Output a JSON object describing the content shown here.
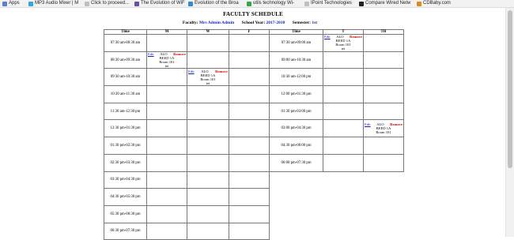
{
  "bookmarks": [
    {
      "label": "Apps",
      "icon": "apps-grid-icon"
    },
    {
      "label": "MP3 Audio Mixer | M",
      "icon": "page-icon"
    },
    {
      "label": "Click to proceed...",
      "icon": "page-icon"
    },
    {
      "label": "The Evolution of WiF",
      "icon": "page-icon"
    },
    {
      "label": "Evolution of the Broa",
      "icon": "page-icon"
    },
    {
      "label": "utils technology Wi-",
      "icon": "page-icon"
    },
    {
      "label": "IPoint Technologies",
      "icon": "page-icon"
    },
    {
      "label": "Compare Wired Netw",
      "icon": "page-icon"
    },
    {
      "label": "CDBaby.com",
      "icon": "page-icon"
    }
  ],
  "title": "FACULTY SCHEDULE",
  "info": {
    "faculty_label": "Faculty:",
    "faculty_value": "Mrs Admin Admin",
    "year_label": "School Year:",
    "year_value": "2017-2018",
    "semester_label": "Semester:",
    "semester_value": "1st"
  },
  "mwf": {
    "headers": [
      "Time",
      "M",
      "W",
      "F"
    ],
    "times": [
      "07:30 am-08:30 am",
      "08:30 am-09:30 am",
      "09:30 am-10:30 am",
      "10:30 am-11:30 am",
      "11:30 am-12:30 pm",
      "12:30 pm-01:30 pm",
      "01:30 pm-02:30 pm",
      "02:30 pm-03:30 pm",
      "03:30 pm-04:30 pm",
      "04:30 pm-05:30 pm",
      "05:30 pm-06:30 pm",
      "06:30 pm-07:30 pm"
    ]
  },
  "tth": {
    "headers": [
      "Time",
      "T",
      "TH"
    ],
    "times": [
      "07:30 am-09:00 am",
      "09:00 am-10:30 am",
      "10:30 am-12:00 pm",
      "12:00 pm-01:30 pm",
      "01:30 pm-03:00 pm",
      "03:00 pm-04:30 pm",
      "04:30 pm-06:00 pm",
      "06:00 pm-07:30 pm"
    ]
  },
  "entry_labels": {
    "edit": "Edit",
    "remove": "Remove"
  },
  "entries": {
    "m1": {
      "subject": "ALO",
      "section": "BEED 1A",
      "room": "Room 101",
      "extra": "tet"
    },
    "w2": {
      "subject": "ALO",
      "section": "BEED 1A",
      "room": "Room 101",
      "extra": "tet"
    },
    "t0": {
      "subject": "ALO",
      "section": "BEED 1A",
      "room": "Room 101",
      "extra": "tet"
    },
    "th5": {
      "subject": "ALO",
      "section": "BEED 1A",
      "room": "Room 101",
      "extra": ""
    }
  },
  "colors": {
    "link": "#0b24c2",
    "remove": "#cc0000"
  }
}
